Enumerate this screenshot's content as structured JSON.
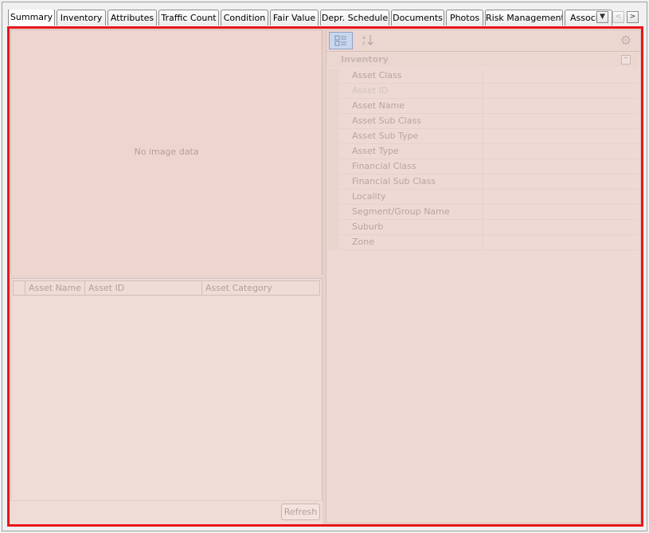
{
  "tabs": [
    {
      "label": "Summary",
      "active": true
    },
    {
      "label": "Inventory"
    },
    {
      "label": "Attributes"
    },
    {
      "label": "Traffic Count"
    },
    {
      "label": "Condition"
    },
    {
      "label": "Fair Value"
    },
    {
      "label": "Depr. Schedule"
    },
    {
      "label": "Documents"
    },
    {
      "label": "Photos"
    },
    {
      "label": "Risk Management"
    },
    {
      "label": "Associ"
    }
  ],
  "tab_controls": {
    "dropdown": "▼",
    "prev": "<",
    "next": ">"
  },
  "image_panel": {
    "message": "No image data"
  },
  "asset_grid": {
    "columns": [
      "Asset Name",
      "Asset ID",
      "Asset Category"
    ],
    "refresh_label": "Refresh"
  },
  "properties": {
    "category": "Inventory",
    "items": [
      "Asset Class",
      "Asset ID",
      "Asset Name",
      "Asset Sub Class",
      "Asset Sub Type",
      "Asset Type",
      "Financial Class",
      "Financial Sub Class",
      "Locality",
      "Segment/Group Name",
      "Suburb",
      "Zone"
    ]
  },
  "colors": {
    "highlight": "#e8151b"
  },
  "icons": [
    "categorized-view-icon",
    "alphabetical-sort-icon",
    "gear-icon",
    "collapse-icon"
  ]
}
